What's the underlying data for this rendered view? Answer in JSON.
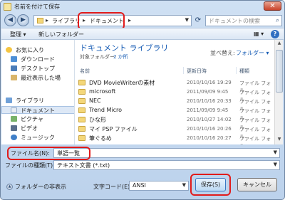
{
  "window": {
    "title": "名前を付けて保存",
    "close": "✕"
  },
  "address": {
    "crumbs": [
      "ライブラリ",
      "ドキュメント"
    ],
    "separator": "▸",
    "search_placeholder": "ドキュメントの検索"
  },
  "toolbar": {
    "organize": "整理 ▾",
    "new_folder": "新しいフォルダー",
    "view": "▦ ▾",
    "help": "?"
  },
  "sidebar": {
    "items": [
      {
        "label": "お気に入り",
        "icon": "star-icon"
      },
      {
        "label": "ダウンロード",
        "icon": "download-folder-icon"
      },
      {
        "label": "デスクトップ",
        "icon": "desktop-icon"
      },
      {
        "label": "最近表示した場",
        "icon": "recent-places-icon"
      },
      {
        "label": "ライブラリ",
        "icon": "library-icon"
      },
      {
        "label": "ドキュメント",
        "icon": "documents-icon"
      },
      {
        "label": "ピクチャ",
        "icon": "pictures-icon"
      },
      {
        "label": "ビデオ",
        "icon": "videos-icon"
      },
      {
        "label": "ミュージック",
        "icon": "music-icon"
      }
    ]
  },
  "content": {
    "title": "ドキュメント ライブラリ",
    "subtitle_label": "対象フォルダー:",
    "subtitle_link": "2 か所",
    "arrange_label": "並べ替え:",
    "arrange_value": "フォルダー ▾",
    "columns": [
      "名前",
      "更新日時",
      "種類"
    ],
    "files": [
      {
        "name": "DVD MovieWriterの素材",
        "date": "2010/10/16 19:29",
        "type": "ファイル フォル..."
      },
      {
        "name": "microsoft",
        "date": "2011/09/09 9:45",
        "type": "ファイル フォル..."
      },
      {
        "name": "NEC",
        "date": "2010/10/16 20:33",
        "type": "ファイル フォル..."
      },
      {
        "name": "Trend Micro",
        "date": "2011/09/09 9:45",
        "type": "ファイル フォル..."
      },
      {
        "name": "ひな形",
        "date": "2010/10/27 14:02",
        "type": "ファイル フォル..."
      },
      {
        "name": "マイ PSP ファイル",
        "date": "2010/10/16 20:26",
        "type": "ファイル フォル..."
      },
      {
        "name": "筆ぐるめ",
        "date": "2010/10/16 20:27",
        "type": "ファイル フォル..."
      }
    ]
  },
  "form": {
    "filename_label": "ファイル名(N):",
    "filename_value": "単語一覧",
    "filetype_label": "ファイルの種類(T):",
    "filetype_value": "テキスト文書 (*.txt)",
    "hide_folders": "フォルダーの非表示",
    "encoding_label": "文字コード(E):",
    "encoding_value": "ANSI",
    "save": "保存(S)",
    "cancel": "キャンセル"
  },
  "colors": {
    "highlight": "#e11b1b",
    "accent": "#1b5fb6"
  }
}
